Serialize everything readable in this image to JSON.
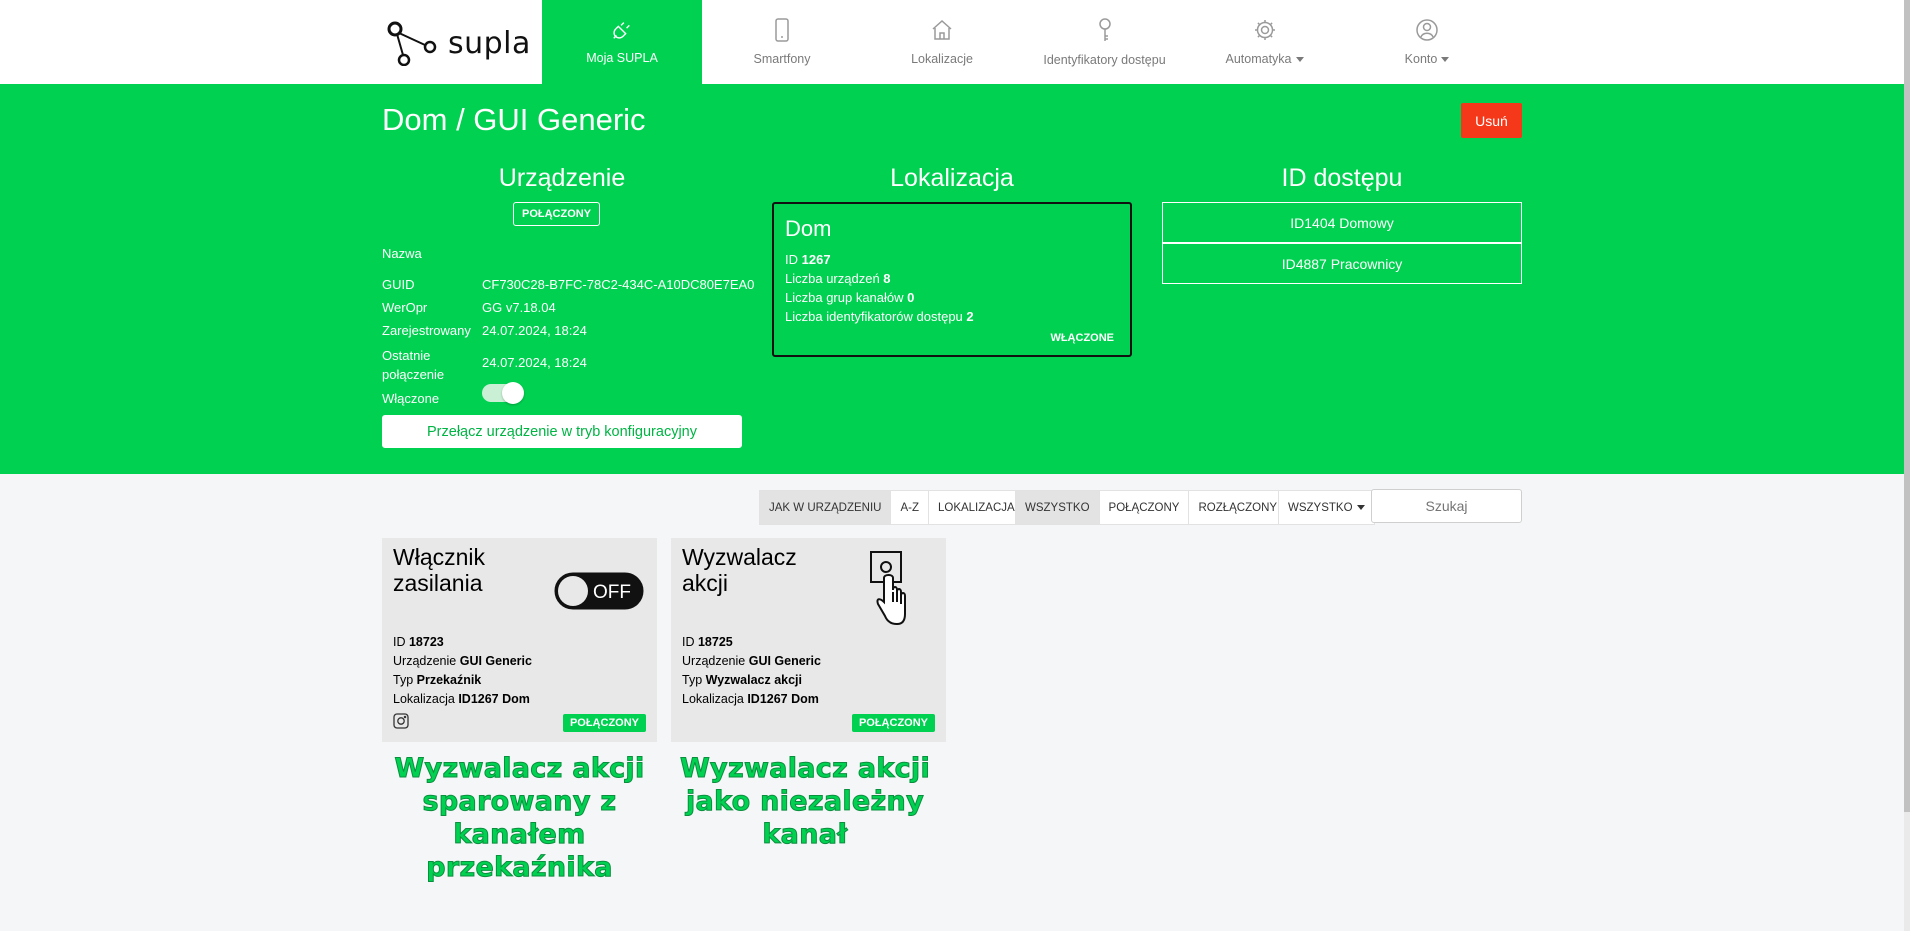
{
  "brand": {
    "name": "supla"
  },
  "nav": {
    "items": [
      {
        "label": "Moja SUPLA",
        "icon": "plug-icon",
        "active": true
      },
      {
        "label": "Smartfony",
        "icon": "smartphone-icon"
      },
      {
        "label": "Lokalizacje",
        "icon": "home-icon"
      },
      {
        "label": "Identyfikatory dostępu",
        "icon": "key-icon"
      },
      {
        "label": "Automatyka",
        "icon": "gear-icon",
        "dropdown": true
      },
      {
        "label": "Konto",
        "icon": "user-icon",
        "dropdown": true
      }
    ]
  },
  "header": {
    "title": "Dom / GUI Generic",
    "delete_label": "Usuń"
  },
  "device": {
    "section_title": "Urządzenie",
    "status": "POŁĄCZONY",
    "props": [
      {
        "label": "Nazwa",
        "value": ""
      },
      {
        "label": "GUID",
        "value": "CF730C28-B7FC-78C2-434C-A10DC80E7EA0"
      },
      {
        "label": "WerOpr",
        "value": "GG v7.18.04"
      },
      {
        "label": "Zarejestrowany",
        "value": "24.07.2024, 18:24"
      },
      {
        "label": "Ostatnie\npołączenie",
        "value": "24.07.2024, 18:24"
      },
      {
        "label": "Włączone",
        "value": ""
      }
    ],
    "enabled": true,
    "config_button": "Przełącz urządzenie w tryb konfiguracyjny"
  },
  "location": {
    "section_title": "Lokalizacja",
    "name": "Dom",
    "lines": [
      {
        "label": "ID",
        "value": "1267"
      },
      {
        "label": "Liczba urządzeń",
        "value": "8"
      },
      {
        "label": "Liczba grup kanałów",
        "value": "0"
      },
      {
        "label": "Liczba identyfikatorów dostępu",
        "value": "2"
      }
    ],
    "status": "WŁĄCZONE"
  },
  "access_ids": {
    "section_title": "ID dostępu",
    "items": [
      "ID1404 Domowy",
      "ID4887 Pracownicy"
    ]
  },
  "filters": {
    "sort": [
      "JAK W URZĄDZENIU",
      "A-Z",
      "LOKALIZACJA"
    ],
    "sort_active": 0,
    "connection": [
      "WSZYSTKO",
      "POŁĄCZONY",
      "ROZŁĄCZONY"
    ],
    "connection_active": 0,
    "type_dropdown": "WSZYSTKO",
    "search_placeholder": "Szukaj"
  },
  "channels": [
    {
      "title": "Włącznik\nzasilania",
      "icon": "power-switch-off-icon",
      "switch_label": "OFF",
      "lines": [
        {
          "label": "ID",
          "value": "18723"
        },
        {
          "label": "Urządzenie",
          "value": "GUI Generic"
        },
        {
          "label": "Typ",
          "value": "Przekaźnik"
        },
        {
          "label": "Lokalizacja",
          "value": "ID1267 Dom"
        }
      ],
      "status": "POŁĄCZONY",
      "extra_icon": "instagram-icon"
    },
    {
      "title": "Wyzwalacz\nakcji",
      "icon": "button-press-icon",
      "lines": [
        {
          "label": "ID",
          "value": "18725"
        },
        {
          "label": "Urządzenie",
          "value": "GUI Generic"
        },
        {
          "label": "Typ",
          "value": "Wyzwalacz akcji"
        },
        {
          "label": "Lokalizacja",
          "value": "ID1267 Dom"
        }
      ],
      "status": "POŁĄCZONY"
    }
  ],
  "captions": [
    "Wyzwalacz akcji\nsparowany z\nkanałem przekaźnika",
    "Wyzwalacz akcji\njako niezależny\nkanał"
  ],
  "colors": {
    "brand_green": "#00d151",
    "delete_red": "#f5381a"
  }
}
